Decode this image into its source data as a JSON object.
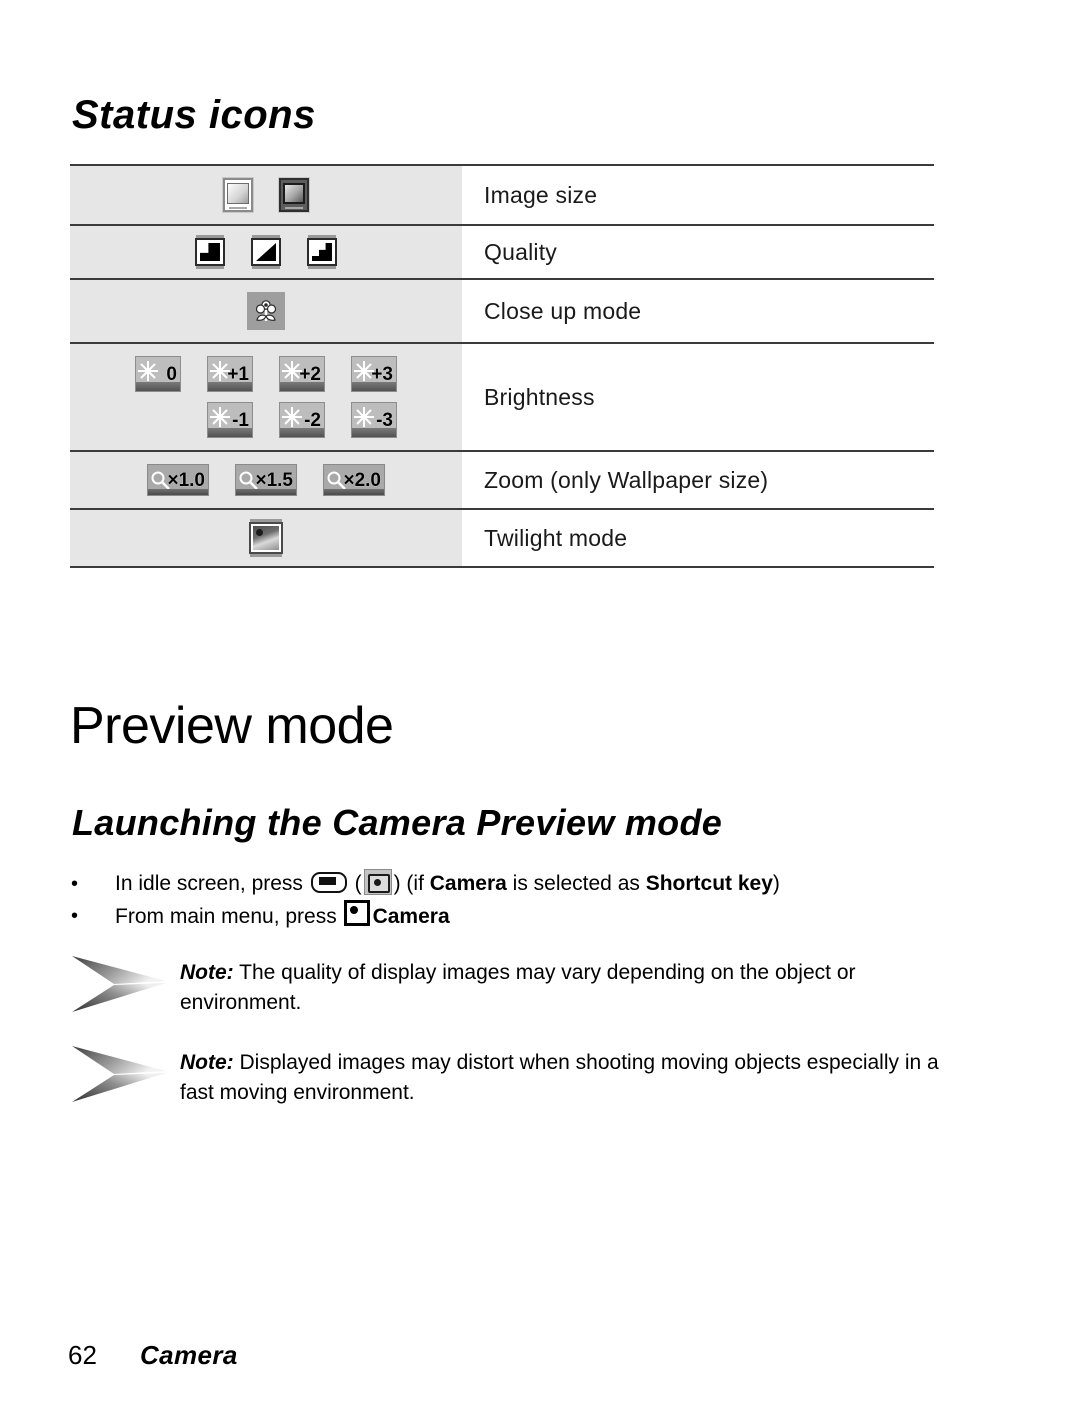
{
  "page": {
    "number": "62",
    "section": "Camera"
  },
  "section_title": "Status icons",
  "status_table": {
    "rows": [
      {
        "label": "Image size",
        "icon_group": "image-size",
        "icons": [
          {
            "name": "image-size-large-icon",
            "variant": "light"
          },
          {
            "name": "image-size-small-icon",
            "variant": "dark"
          }
        ]
      },
      {
        "label": "Quality",
        "icon_group": "quality",
        "icons": [
          {
            "name": "quality-super-fine-icon",
            "variant": "q1"
          },
          {
            "name": "quality-fine-icon",
            "variant": "q2"
          },
          {
            "name": "quality-normal-icon",
            "variant": "q3"
          }
        ]
      },
      {
        "label": "Close up mode",
        "icon_group": "close-up",
        "icons": [
          {
            "name": "close-up-flower-icon",
            "variant": "flower"
          }
        ]
      },
      {
        "label": "Brightness",
        "icon_group": "brightness",
        "icons_line1": [
          {
            "name": "brightness-0-icon",
            "value": "0"
          },
          {
            "name": "brightness-plus-1-icon",
            "value": "+1"
          },
          {
            "name": "brightness-plus-2-icon",
            "value": "+2"
          },
          {
            "name": "brightness-plus-3-icon",
            "value": "+3"
          }
        ],
        "icons_line2": [
          {
            "name": "brightness-minus-1-icon",
            "value": "-1"
          },
          {
            "name": "brightness-minus-2-icon",
            "value": "-2"
          },
          {
            "name": "brightness-minus-3-icon",
            "value": "-3"
          }
        ]
      },
      {
        "label": "Zoom (only Wallpaper size)",
        "icon_group": "zoom",
        "icons": [
          {
            "name": "zoom-x1-0-icon",
            "value": "×1.0"
          },
          {
            "name": "zoom-x1-5-icon",
            "value": "×1.5"
          },
          {
            "name": "zoom-x2-0-icon",
            "value": "×2.0"
          }
        ]
      },
      {
        "label": "Twilight mode",
        "icon_group": "twilight",
        "icons": [
          {
            "name": "twilight-mode-icon",
            "variant": "twilight"
          }
        ]
      }
    ]
  },
  "preview_heading": "Preview mode",
  "launching_heading": "Launching the Camera Preview mode",
  "bullets": [
    {
      "marker": "•",
      "parts": [
        {
          "type": "text",
          "text": "In idle screen, press "
        },
        {
          "type": "icon",
          "name": "soft-key-icon"
        },
        {
          "type": "text",
          "text": " ("
        },
        {
          "type": "icon",
          "name": "camera-key-icon"
        },
        {
          "type": "text",
          "text": ") (if "
        },
        {
          "type": "bold",
          "text": "Camera"
        },
        {
          "type": "text",
          "text": " is selected as "
        },
        {
          "type": "bold",
          "text": "Shortcut key"
        },
        {
          "type": "text",
          "text": ")"
        }
      ]
    },
    {
      "marker": "•",
      "parts": [
        {
          "type": "text",
          "text": "From main menu, press "
        },
        {
          "type": "icon",
          "name": "ok-key-icon"
        },
        {
          "type": "bold",
          "text": "Camera"
        }
      ]
    }
  ],
  "notes": [
    {
      "label": "Note:",
      "text": "The quality of display images may vary depending on the object or environment."
    },
    {
      "label": "Note:",
      "text": "Displayed images may distort when shooting moving objects especially in a fast moving environment."
    }
  ],
  "colors": {
    "icon_cell_background": "#e6e6e6",
    "rule": "#3b3b3b",
    "text": "#000000"
  }
}
